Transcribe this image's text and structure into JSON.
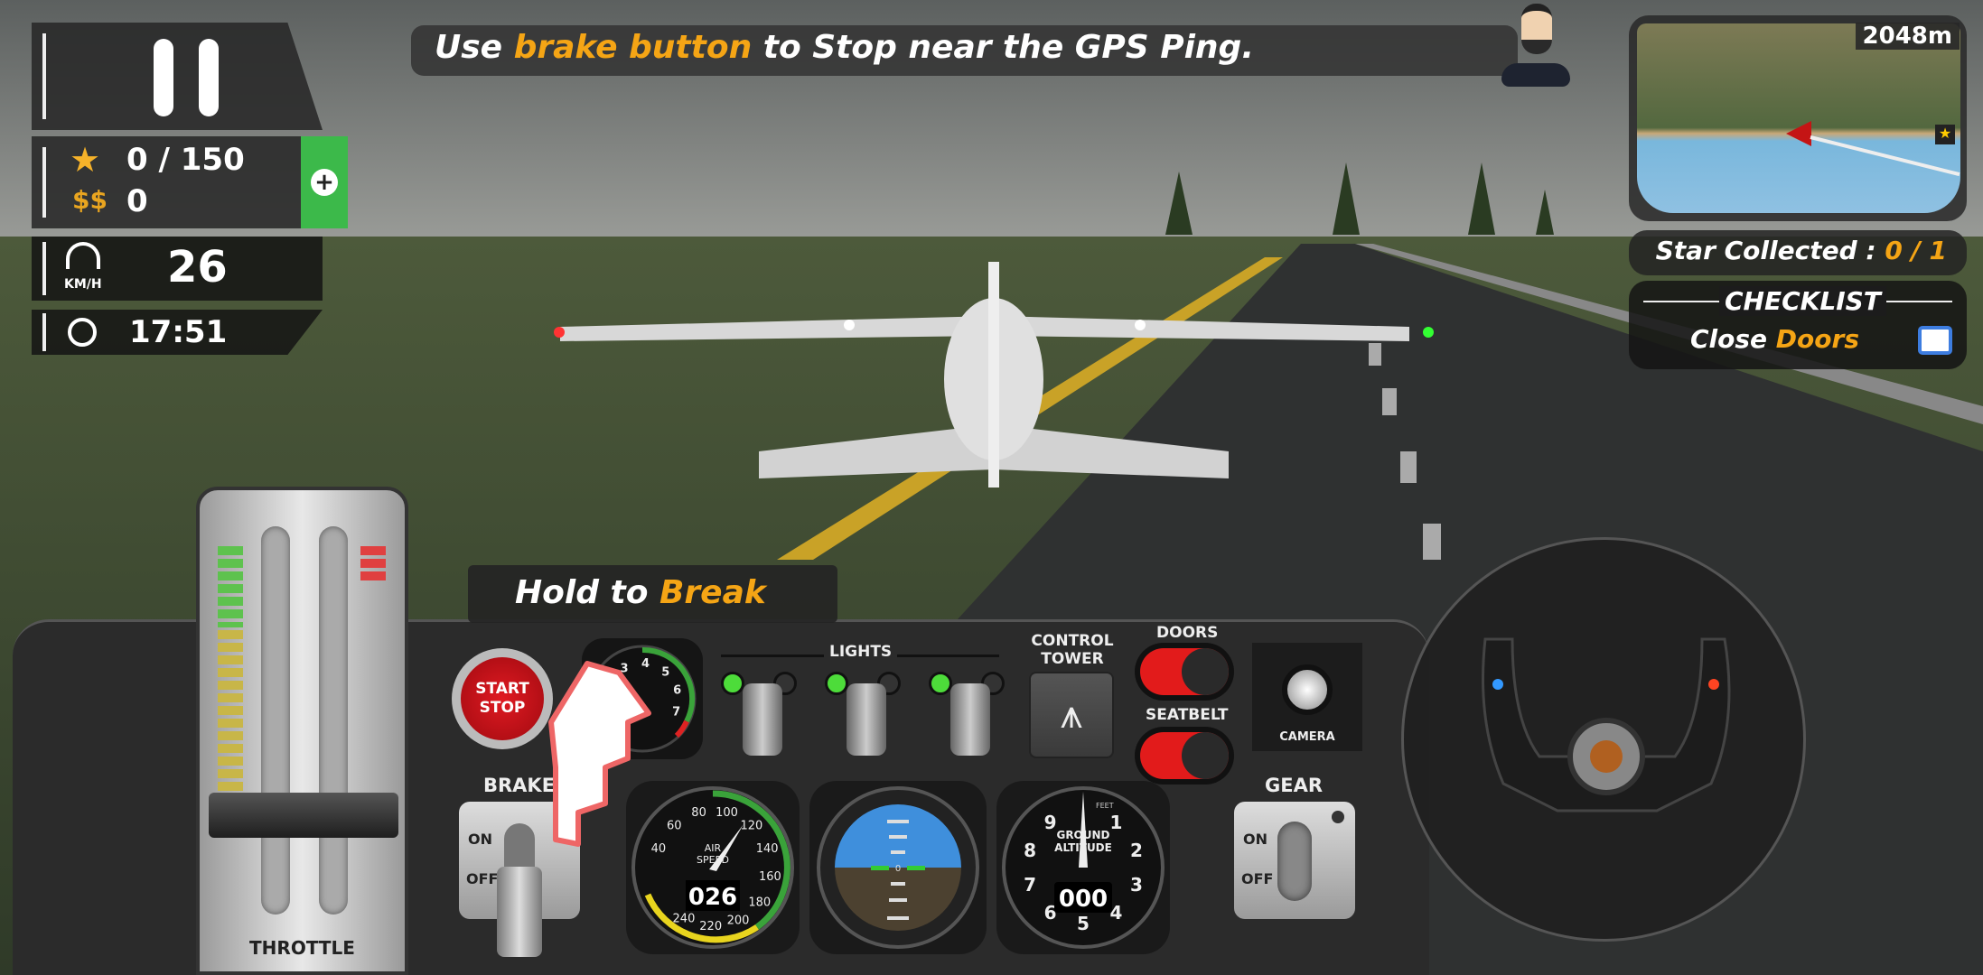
{
  "hud": {
    "stars": "0 / 150",
    "coins": "0",
    "speed": "26",
    "speed_unit": "KM/H",
    "time": "17:51"
  },
  "instruction": {
    "part1": "Use ",
    "highlight": "brake button",
    "part2": " to Stop near the GPS Ping."
  },
  "minimap": {
    "distance": "2048m"
  },
  "star_collected": {
    "label": "Star Collected : ",
    "value": "0 / 1"
  },
  "checklist": {
    "title": "CHECKLIST",
    "item_word": "Close ",
    "item_highlight": "Doors",
    "checked": false
  },
  "hold_hint": {
    "part1": "Hold to ",
    "highlight": "Break"
  },
  "dashboard": {
    "throttle_label": "THROTTLE",
    "start_stop": [
      "START",
      "STOP"
    ],
    "lights_label": "LIGHTS",
    "lights_state": [
      true,
      true,
      true
    ],
    "control_tower": [
      "CONTROL",
      "TOWER"
    ],
    "doors_label": "DOORS",
    "seatbelt_label": "SEATBELT",
    "camera_label": "CAMERA",
    "brake": {
      "label": "BRAKE",
      "on": "ON",
      "off": "OFF",
      "state": "OFF"
    },
    "gear": {
      "label": "GEAR",
      "on": "ON",
      "off": "OFF"
    },
    "rpm_gauge": {
      "ticks": [
        "3",
        "4",
        "5",
        "6",
        "7"
      ]
    },
    "airspeed": {
      "label": [
        "AIR",
        "SPEED"
      ],
      "readout": "026",
      "ticks": [
        "40",
        "60",
        "80",
        "100",
        "120",
        "140",
        "160",
        "180",
        "200",
        "220",
        "240"
      ]
    },
    "altitude": {
      "label": [
        "GROUND",
        "ALTITUDE"
      ],
      "unit": "FEET",
      "readout": "000",
      "ticks": [
        "1",
        "2",
        "3",
        "4",
        "5",
        "6",
        "7",
        "8",
        "9"
      ]
    },
    "attitude": {
      "center": "0"
    }
  },
  "colors": {
    "accent": "#f5a515",
    "hud_bg": "#282828",
    "green_button": "#3cb94a",
    "start_red": "#d0101a"
  }
}
